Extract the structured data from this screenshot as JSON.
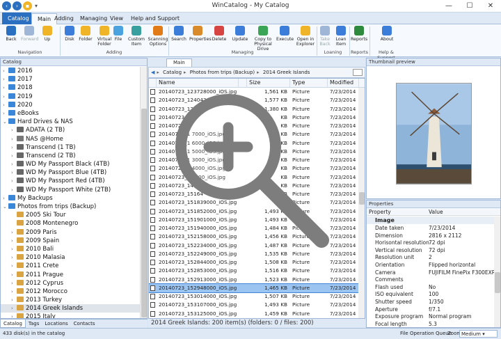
{
  "window": {
    "title": "WinCatalog - My Catalog"
  },
  "ribbon_tabs": [
    "Catalog",
    "Main",
    "Adding",
    "Managing",
    "View",
    "Help and Support"
  ],
  "ribbon": {
    "buttons": [
      {
        "label": "Back",
        "icon": "back-arrow-icon",
        "color": "#2a6fc0",
        "enabled": true
      },
      {
        "label": "Forward",
        "icon": "forward-arrow-icon",
        "color": "#9fb6d6",
        "enabled": false
      },
      {
        "label": "Up",
        "icon": "folder-up-icon",
        "color": "#f0b429",
        "enabled": true
      },
      {
        "label": "Disk",
        "icon": "disk-add-icon",
        "color": "#3b7dd8",
        "enabled": true
      },
      {
        "label": "Folder",
        "icon": "folder-add-icon",
        "color": "#f0b429",
        "enabled": true
      },
      {
        "label": "Virtual Folder",
        "icon": "virtual-folder-icon",
        "color": "#f0b429",
        "enabled": true
      },
      {
        "label": "File",
        "icon": "file-add-icon",
        "color": "#4aa3df",
        "enabled": true
      },
      {
        "label": "Custom Item",
        "icon": "custom-item-icon",
        "color": "#39a0a0",
        "enabled": true
      },
      {
        "label": "Scanning Options",
        "icon": "gear-icon",
        "color": "#e07b18",
        "enabled": true
      },
      {
        "label": "Search",
        "icon": "search-icon",
        "color": "#3b7dd8",
        "enabled": true
      },
      {
        "label": "Properties",
        "icon": "properties-icon",
        "color": "#d98a2b",
        "enabled": true
      },
      {
        "label": "Delete",
        "icon": "delete-icon",
        "color": "#d64541",
        "enabled": true
      },
      {
        "label": "Update",
        "icon": "update-icon",
        "color": "#3b7dd8",
        "enabled": true
      },
      {
        "label": "Copy to Physical Drive",
        "icon": "copy-icon",
        "color": "#3aa655",
        "enabled": true
      },
      {
        "label": "Execute",
        "icon": "execute-icon",
        "color": "#3b7dd8",
        "enabled": true
      },
      {
        "label": "Open in Explorer",
        "icon": "explorer-icon",
        "color": "#f0b429",
        "enabled": true
      },
      {
        "label": "Take Back",
        "icon": "take-back-icon",
        "color": "#9fb6d6",
        "enabled": false
      },
      {
        "label": "Loan Item",
        "icon": "loan-icon",
        "color": "#3b7dd8",
        "enabled": true
      },
      {
        "label": "Reports",
        "icon": "excel-icon",
        "color": "#2e8b3e",
        "enabled": true
      },
      {
        "label": "About",
        "icon": "info-icon",
        "color": "#3b7dd8",
        "enabled": true
      }
    ],
    "groups": [
      "Navigation",
      "Adding",
      "Managing",
      "Loaning",
      "Reports",
      "Help & Support"
    ]
  },
  "catalog": {
    "header": "Catalog",
    "tree": [
      {
        "label": "2016",
        "kind": "folder-blue",
        "arrow": ">",
        "indent": 0
      },
      {
        "label": "2017",
        "kind": "folder-blue",
        "arrow": ">",
        "indent": 0
      },
      {
        "label": "2018",
        "kind": "folder-blue",
        "arrow": ">",
        "indent": 0
      },
      {
        "label": "2019",
        "kind": "folder-blue",
        "arrow": ">",
        "indent": 0
      },
      {
        "label": "2020",
        "kind": "folder-blue",
        "arrow": ">",
        "indent": 0
      },
      {
        "label": "eBooks",
        "kind": "folder-blue",
        "arrow": ">",
        "indent": 0
      },
      {
        "label": "Hard Drives & NAS",
        "kind": "folder-blue",
        "arrow": "v",
        "indent": 0
      },
      {
        "label": "ADATA (2 TB)",
        "kind": "drive",
        "arrow": ">",
        "indent": 1
      },
      {
        "label": "NAS @Home",
        "kind": "nas",
        "arrow": ">",
        "indent": 1
      },
      {
        "label": "Transcend (1 TB)",
        "kind": "drive",
        "arrow": ">",
        "indent": 1
      },
      {
        "label": "Transcend (2 TB)",
        "kind": "drive",
        "arrow": ">",
        "indent": 1
      },
      {
        "label": "WD My Passport Black (4TB)",
        "kind": "drive",
        "arrow": ">",
        "indent": 1
      },
      {
        "label": "WD My Passport Blue (4TB)",
        "kind": "drive",
        "arrow": ">",
        "indent": 1
      },
      {
        "label": "WD My Passport Red (4TB)",
        "kind": "drive",
        "arrow": ">",
        "indent": 1
      },
      {
        "label": "WD My Passport White (2TB)",
        "kind": "drive",
        "arrow": ">",
        "indent": 1
      },
      {
        "label": "My Backups",
        "kind": "folder-blue",
        "arrow": ">",
        "indent": 0
      },
      {
        "label": "Photos from trips (Backup)",
        "kind": "folder-blue",
        "arrow": "v",
        "indent": 0
      },
      {
        "label": "2005 Ski Tour",
        "kind": "folder-gear",
        "arrow": "",
        "indent": 1
      },
      {
        "label": "2008 Montenegro",
        "kind": "folder-gear",
        "arrow": "",
        "indent": 1
      },
      {
        "label": "2009 Paris",
        "kind": "folder-gear",
        "arrow": ">",
        "indent": 1
      },
      {
        "label": "2009 Spain",
        "kind": "folder-gear",
        "arrow": ">",
        "indent": 1
      },
      {
        "label": "2010 Bali",
        "kind": "folder-gear",
        "arrow": ">",
        "indent": 1
      },
      {
        "label": "2010 Malasia",
        "kind": "folder-gear",
        "arrow": ">",
        "indent": 1
      },
      {
        "label": "2011 Crete",
        "kind": "folder-gear",
        "arrow": ">",
        "indent": 1
      },
      {
        "label": "2011 Prague",
        "kind": "folder-gear",
        "arrow": ">",
        "indent": 1
      },
      {
        "label": "2012 Cyprus",
        "kind": "folder-gear",
        "arrow": ">",
        "indent": 1
      },
      {
        "label": "2012 Morocco",
        "kind": "folder-gear",
        "arrow": ">",
        "indent": 1
      },
      {
        "label": "2013 Turkey",
        "kind": "folder-gear",
        "arrow": ">",
        "indent": 1
      },
      {
        "label": "2014 Greek Islands",
        "kind": "folder-gear",
        "arrow": ">",
        "indent": 1,
        "selected": true
      },
      {
        "label": "2015 Italy",
        "kind": "folder-gear",
        "arrow": ">",
        "indent": 1
      }
    ],
    "bottom_tabs": [
      "Catalog",
      "Tags",
      "Locations",
      "Contacts"
    ]
  },
  "main": {
    "tab": "Main",
    "breadcrumb": [
      "Catalog",
      "Photos from trips (Backup)",
      "2014 Greek Islands"
    ],
    "columns": [
      "Name",
      "Size",
      "Type",
      "Modified"
    ],
    "rows": [
      {
        "name": "20140723_123728000_iOS.jpg",
        "size": "1,561 KB",
        "type": "Picture",
        "modified": "7/23/2014"
      },
      {
        "name": "20140723_124042000_iOS.jpg",
        "size": "1,577 KB",
        "type": "Picture",
        "modified": "7/23/2014"
      },
      {
        "name": "20140723_124",
        "size": "1,380 KB",
        "type": "Picture",
        "modified": "7/23/2014"
      },
      {
        "name": "20140723_1",
        "size": "KB",
        "type": "Picture",
        "modified": "7/23/2014"
      },
      {
        "name": "20140723_1",
        "size": "KB",
        "type": "Picture",
        "modified": "7/23/2014"
      },
      {
        "name": "20140723_1 7000_iOS.jpg",
        "size": "KB",
        "type": "Picture",
        "modified": "7/23/2014"
      },
      {
        "name": "20140723_1 6000_iOS.jpg",
        "size": "KB",
        "type": "Picture",
        "modified": "7/23/2014"
      },
      {
        "name": "20140723_1 5000_iOS.jpg",
        "size": "KB",
        "type": "Picture",
        "modified": "7/23/2014"
      },
      {
        "name": "20140723_1 3000_iOS.jpg",
        "size": "KB",
        "type": "Picture",
        "modified": "7/23/2014"
      },
      {
        "name": "20140723_1 4000_iOS.jpg",
        "size": "KB",
        "type": "Picture",
        "modified": "7/23/2014"
      },
      {
        "name": "20140723_1 9000_iOS.jpg",
        "size": "KB",
        "type": "Picture",
        "modified": "7/23/2014"
      },
      {
        "name": "20140723_145",
        "size": "KB",
        "type": "Picture",
        "modified": "7/23/2014"
      },
      {
        "name": "20140723_15164",
        "size": "KB",
        "type": "Picture",
        "modified": "7/23/2014"
      },
      {
        "name": "20140723_151839000_iOS.jpg",
        "size": "KB",
        "type": "Picture",
        "modified": "7/23/2014"
      },
      {
        "name": "20140723_151852000_iOS.jpg",
        "size": "1,493 KB",
        "type": "Picture",
        "modified": "7/23/2014"
      },
      {
        "name": "20140723_151901000_iOS.jpg",
        "size": "1,493 KB",
        "type": "Picture",
        "modified": "7/23/2014"
      },
      {
        "name": "20140723_151940000_iOS.jpg",
        "size": "1,484 KB",
        "type": "Picture",
        "modified": "7/23/2014"
      },
      {
        "name": "20140723_152158000_iOS.jpg",
        "size": "1,456 KB",
        "type": "Picture",
        "modified": "7/23/2014"
      },
      {
        "name": "20140723_152234000_iOS.jpg",
        "size": "1,487 KB",
        "type": "Picture",
        "modified": "7/23/2014"
      },
      {
        "name": "20140723_152249000_iOS.jpg",
        "size": "1,535 KB",
        "type": "Picture",
        "modified": "7/23/2014"
      },
      {
        "name": "20140723_152844000_iOS.jpg",
        "size": "1,508 KB",
        "type": "Picture",
        "modified": "7/23/2014"
      },
      {
        "name": "20140723_152853000_iOS.jpg",
        "size": "1,516 KB",
        "type": "Picture",
        "modified": "7/23/2014"
      },
      {
        "name": "20140723_152913000_iOS.jpg",
        "size": "1,523 KB",
        "type": "Picture",
        "modified": "7/23/2014"
      },
      {
        "name": "20140723_152948000_iOS.jpg",
        "size": "1,465 KB",
        "type": "Picture",
        "modified": "7/23/2014",
        "selected": true
      },
      {
        "name": "20140723_153014000_iOS.jpg",
        "size": "1,507 KB",
        "type": "Picture",
        "modified": "7/23/2014"
      },
      {
        "name": "20140723_153107000_iOS.jpg",
        "size": "1,493 KB",
        "type": "Picture",
        "modified": "7/23/2014"
      },
      {
        "name": "20140723_153125000_iOS.jpg",
        "size": "1,459 KB",
        "type": "Picture",
        "modified": "7/23/2014"
      }
    ],
    "status": "2014 Greek Islands: 200 item(s) (folders: 0 / files: 200)"
  },
  "preview": {
    "header": "Thumbnail preview"
  },
  "properties": {
    "header": "Properties",
    "columns": [
      "Property",
      "Value"
    ],
    "section": "Image",
    "rows": [
      {
        "k": "Date taken",
        "v": "7/23/2014"
      },
      {
        "k": "Dimension",
        "v": "2816 x 2112"
      },
      {
        "k": "Horisontal resolution",
        "v": "72 dpi"
      },
      {
        "k": "Vertical resolution",
        "v": "72 dpi"
      },
      {
        "k": "Resolution unit",
        "v": "2"
      },
      {
        "k": "Orientation",
        "v": "Flipped horizontal"
      },
      {
        "k": "Camera",
        "v": "FUJIFILM FinePix F300EXR"
      },
      {
        "k": "Comments",
        "v": ""
      },
      {
        "k": "Flash used",
        "v": "No"
      },
      {
        "k": "ISO equivalent",
        "v": "100"
      },
      {
        "k": "Shutter speed",
        "v": "1/350"
      },
      {
        "k": "Aperture",
        "v": "f/7.1"
      },
      {
        "k": "Exposure program",
        "v": "Normal program"
      },
      {
        "k": "Focal length",
        "v": "5.3"
      }
    ]
  },
  "statusbar": {
    "left": "433 disk(s) in the catalog",
    "queue": "File Operation Queue",
    "zoom_label": "Zoom",
    "zoom_value": "Medium"
  }
}
